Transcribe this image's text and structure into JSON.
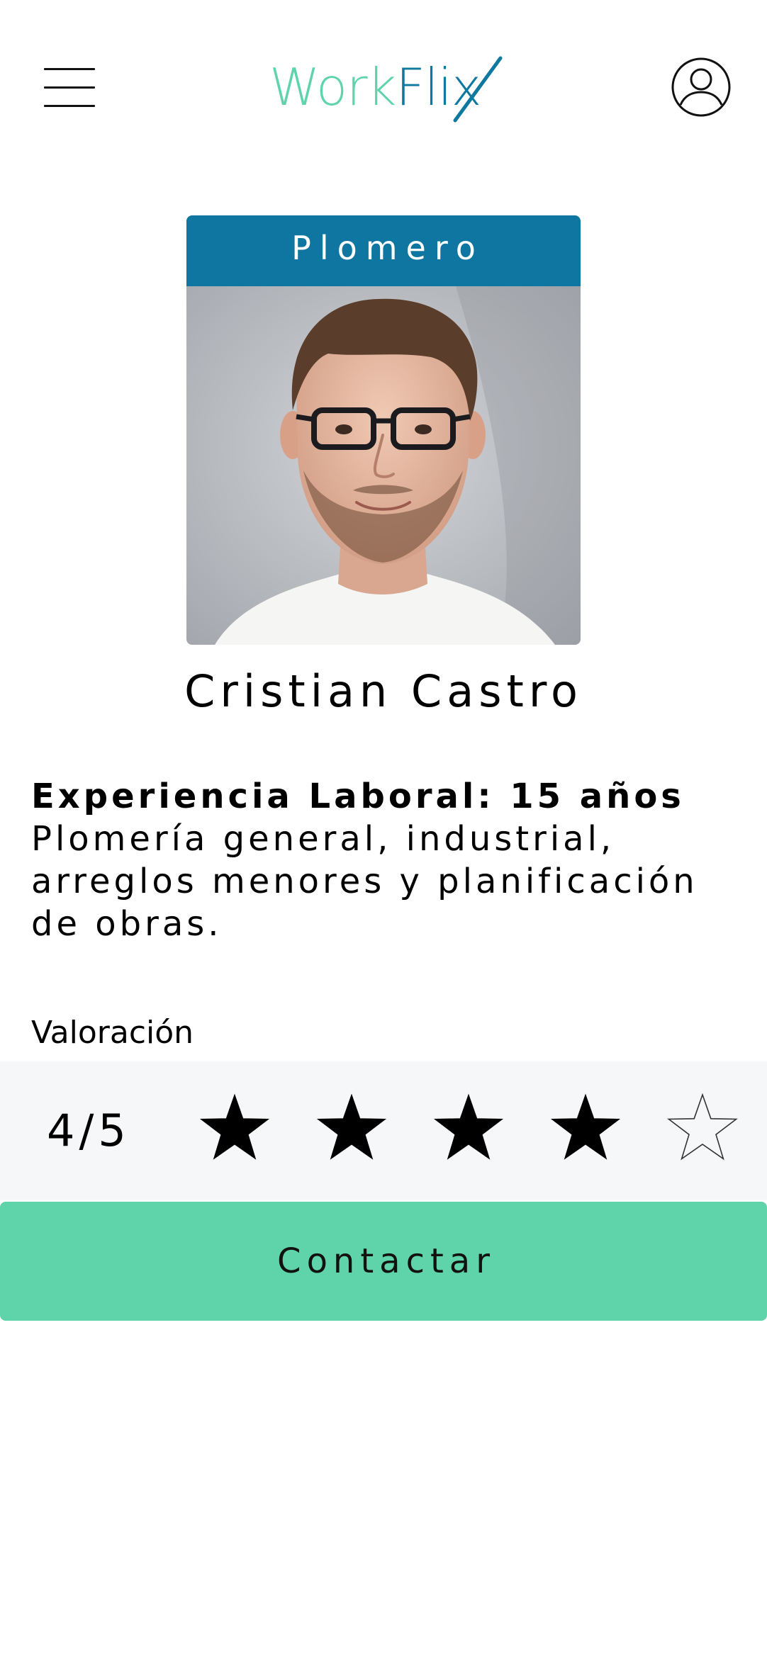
{
  "header": {
    "logo_part1": "Work",
    "logo_part2": "Flix",
    "menu_icon": "hamburger-menu-icon",
    "account_icon": "user-account-icon"
  },
  "profile": {
    "profession": "Plomero",
    "name": "Cristian Castro",
    "experience_title": "Experiencia Laboral: 15 años",
    "experience_desc": "Plomería general, industrial, arreglos menores y planificación de obras."
  },
  "rating": {
    "label": "Valoración",
    "score_text": "4/5",
    "value": 4,
    "max": 5
  },
  "actions": {
    "contact_label": "Contactar"
  },
  "colors": {
    "brand_green": "#5fd4ab",
    "brand_blue": "#0e76a0",
    "rating_bg": "#f6f7f9"
  }
}
